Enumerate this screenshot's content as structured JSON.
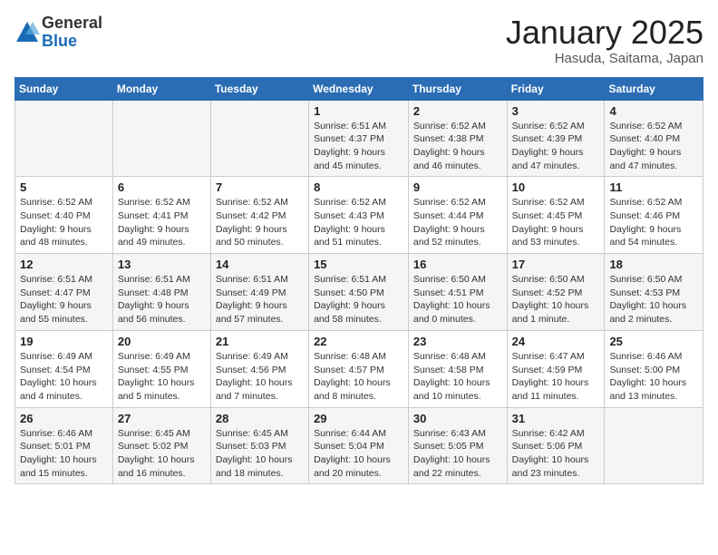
{
  "logo": {
    "general": "General",
    "blue": "Blue"
  },
  "title": "January 2025",
  "subtitle": "Hasuda, Saitama, Japan",
  "days_header": [
    "Sunday",
    "Monday",
    "Tuesday",
    "Wednesday",
    "Thursday",
    "Friday",
    "Saturday"
  ],
  "weeks": [
    [
      {
        "num": "",
        "detail": ""
      },
      {
        "num": "",
        "detail": ""
      },
      {
        "num": "",
        "detail": ""
      },
      {
        "num": "1",
        "detail": "Sunrise: 6:51 AM\nSunset: 4:37 PM\nDaylight: 9 hours\nand 45 minutes."
      },
      {
        "num": "2",
        "detail": "Sunrise: 6:52 AM\nSunset: 4:38 PM\nDaylight: 9 hours\nand 46 minutes."
      },
      {
        "num": "3",
        "detail": "Sunrise: 6:52 AM\nSunset: 4:39 PM\nDaylight: 9 hours\nand 47 minutes."
      },
      {
        "num": "4",
        "detail": "Sunrise: 6:52 AM\nSunset: 4:40 PM\nDaylight: 9 hours\nand 47 minutes."
      }
    ],
    [
      {
        "num": "5",
        "detail": "Sunrise: 6:52 AM\nSunset: 4:40 PM\nDaylight: 9 hours\nand 48 minutes."
      },
      {
        "num": "6",
        "detail": "Sunrise: 6:52 AM\nSunset: 4:41 PM\nDaylight: 9 hours\nand 49 minutes."
      },
      {
        "num": "7",
        "detail": "Sunrise: 6:52 AM\nSunset: 4:42 PM\nDaylight: 9 hours\nand 50 minutes."
      },
      {
        "num": "8",
        "detail": "Sunrise: 6:52 AM\nSunset: 4:43 PM\nDaylight: 9 hours\nand 51 minutes."
      },
      {
        "num": "9",
        "detail": "Sunrise: 6:52 AM\nSunset: 4:44 PM\nDaylight: 9 hours\nand 52 minutes."
      },
      {
        "num": "10",
        "detail": "Sunrise: 6:52 AM\nSunset: 4:45 PM\nDaylight: 9 hours\nand 53 minutes."
      },
      {
        "num": "11",
        "detail": "Sunrise: 6:52 AM\nSunset: 4:46 PM\nDaylight: 9 hours\nand 54 minutes."
      }
    ],
    [
      {
        "num": "12",
        "detail": "Sunrise: 6:51 AM\nSunset: 4:47 PM\nDaylight: 9 hours\nand 55 minutes."
      },
      {
        "num": "13",
        "detail": "Sunrise: 6:51 AM\nSunset: 4:48 PM\nDaylight: 9 hours\nand 56 minutes."
      },
      {
        "num": "14",
        "detail": "Sunrise: 6:51 AM\nSunset: 4:49 PM\nDaylight: 9 hours\nand 57 minutes."
      },
      {
        "num": "15",
        "detail": "Sunrise: 6:51 AM\nSunset: 4:50 PM\nDaylight: 9 hours\nand 58 minutes."
      },
      {
        "num": "16",
        "detail": "Sunrise: 6:50 AM\nSunset: 4:51 PM\nDaylight: 10 hours\nand 0 minutes."
      },
      {
        "num": "17",
        "detail": "Sunrise: 6:50 AM\nSunset: 4:52 PM\nDaylight: 10 hours\nand 1 minute."
      },
      {
        "num": "18",
        "detail": "Sunrise: 6:50 AM\nSunset: 4:53 PM\nDaylight: 10 hours\nand 2 minutes."
      }
    ],
    [
      {
        "num": "19",
        "detail": "Sunrise: 6:49 AM\nSunset: 4:54 PM\nDaylight: 10 hours\nand 4 minutes."
      },
      {
        "num": "20",
        "detail": "Sunrise: 6:49 AM\nSunset: 4:55 PM\nDaylight: 10 hours\nand 5 minutes."
      },
      {
        "num": "21",
        "detail": "Sunrise: 6:49 AM\nSunset: 4:56 PM\nDaylight: 10 hours\nand 7 minutes."
      },
      {
        "num": "22",
        "detail": "Sunrise: 6:48 AM\nSunset: 4:57 PM\nDaylight: 10 hours\nand 8 minutes."
      },
      {
        "num": "23",
        "detail": "Sunrise: 6:48 AM\nSunset: 4:58 PM\nDaylight: 10 hours\nand 10 minutes."
      },
      {
        "num": "24",
        "detail": "Sunrise: 6:47 AM\nSunset: 4:59 PM\nDaylight: 10 hours\nand 11 minutes."
      },
      {
        "num": "25",
        "detail": "Sunrise: 6:46 AM\nSunset: 5:00 PM\nDaylight: 10 hours\nand 13 minutes."
      }
    ],
    [
      {
        "num": "26",
        "detail": "Sunrise: 6:46 AM\nSunset: 5:01 PM\nDaylight: 10 hours\nand 15 minutes."
      },
      {
        "num": "27",
        "detail": "Sunrise: 6:45 AM\nSunset: 5:02 PM\nDaylight: 10 hours\nand 16 minutes."
      },
      {
        "num": "28",
        "detail": "Sunrise: 6:45 AM\nSunset: 5:03 PM\nDaylight: 10 hours\nand 18 minutes."
      },
      {
        "num": "29",
        "detail": "Sunrise: 6:44 AM\nSunset: 5:04 PM\nDaylight: 10 hours\nand 20 minutes."
      },
      {
        "num": "30",
        "detail": "Sunrise: 6:43 AM\nSunset: 5:05 PM\nDaylight: 10 hours\nand 22 minutes."
      },
      {
        "num": "31",
        "detail": "Sunrise: 6:42 AM\nSunset: 5:06 PM\nDaylight: 10 hours\nand 23 minutes."
      },
      {
        "num": "",
        "detail": ""
      }
    ]
  ]
}
